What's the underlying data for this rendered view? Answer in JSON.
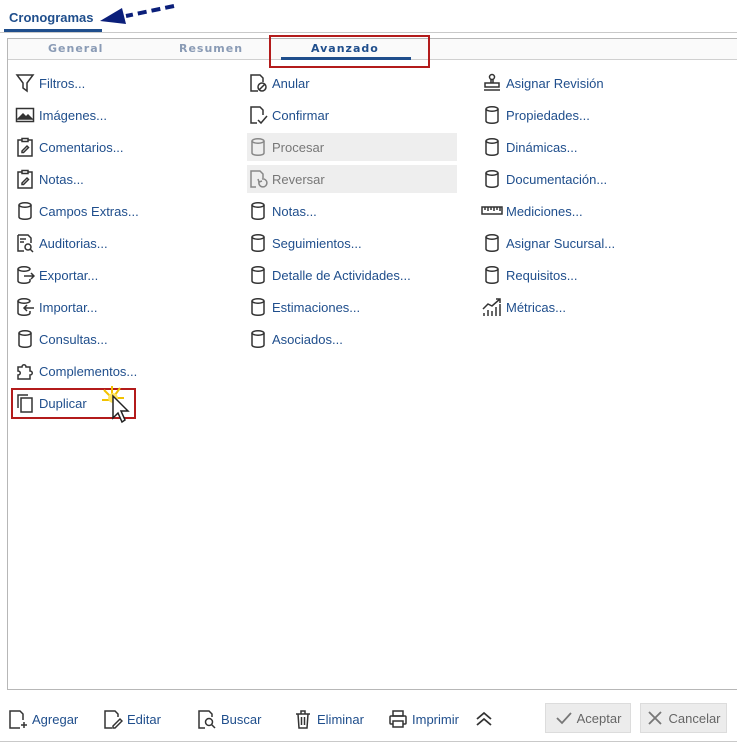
{
  "window": {
    "title": "Cronogramas"
  },
  "tabs": [
    {
      "label": "General"
    },
    {
      "label": "Resumen"
    },
    {
      "label": "Avanzado",
      "active": true
    }
  ],
  "col1": [
    {
      "label": "Filtros...",
      "icon": "filter-icon"
    },
    {
      "label": "Imágenes...",
      "icon": "image-icon"
    },
    {
      "label": "Comentarios...",
      "icon": "clipboard-edit-icon"
    },
    {
      "label": "Notas...",
      "icon": "clipboard-edit-icon"
    },
    {
      "label": "Campos Extras...",
      "icon": "database-icon"
    },
    {
      "label": "Auditorias...",
      "icon": "audit-search-icon"
    },
    {
      "label": "Exportar...",
      "icon": "database-export-icon"
    },
    {
      "label": "Importar...",
      "icon": "database-import-icon"
    },
    {
      "label": "Consultas...",
      "icon": "database-icon"
    },
    {
      "label": "Complementos...",
      "icon": "puzzle-icon"
    },
    {
      "label": "Duplicar",
      "icon": "copy-icon"
    }
  ],
  "col2": [
    {
      "label": "Anular",
      "icon": "doc-cancel-icon"
    },
    {
      "label": "Confirmar",
      "icon": "doc-check-icon"
    },
    {
      "label": "Procesar",
      "icon": "database-icon",
      "disabled": true
    },
    {
      "label": "Reversar",
      "icon": "doc-revert-icon",
      "disabled": true
    },
    {
      "label": "Notas...",
      "icon": "database-icon"
    },
    {
      "label": "Seguimientos...",
      "icon": "database-icon"
    },
    {
      "label": "Detalle de Actividades...",
      "icon": "database-icon"
    },
    {
      "label": "Estimaciones...",
      "icon": "database-icon"
    },
    {
      "label": "Asociados...",
      "icon": "database-icon"
    }
  ],
  "col3": [
    {
      "label": "Asignar Revisión",
      "icon": "stamp-icon"
    },
    {
      "label": "Propiedades...",
      "icon": "database-icon"
    },
    {
      "label": "Dinámicas...",
      "icon": "database-icon"
    },
    {
      "label": "Documentación...",
      "icon": "database-icon"
    },
    {
      "label": "Mediciones...",
      "icon": "ruler-icon"
    },
    {
      "label": "Asignar Sucursal...",
      "icon": "database-icon"
    },
    {
      "label": "Requisitos...",
      "icon": "database-icon"
    },
    {
      "label": "Métricas...",
      "icon": "chart-icon"
    }
  ],
  "toolbar": {
    "add": "Agregar",
    "edit": "Editar",
    "search": "Buscar",
    "delete": "Eliminar",
    "print": "Imprimir",
    "accept": "Aceptar",
    "cancel": "Cancelar"
  }
}
